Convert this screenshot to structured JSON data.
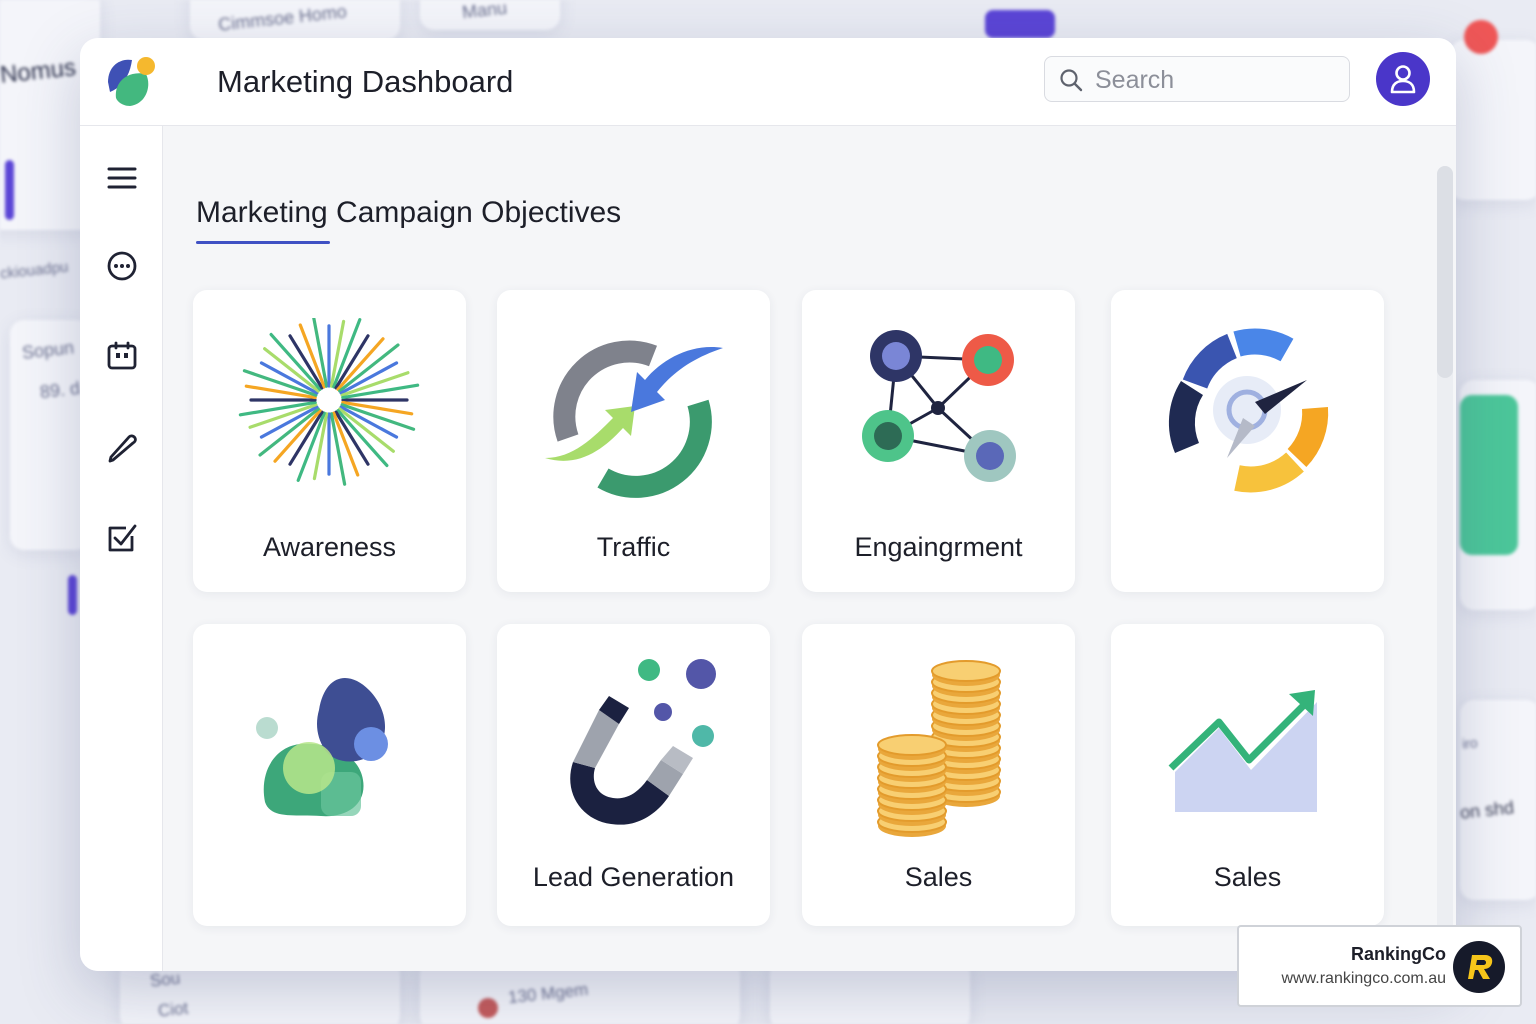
{
  "header": {
    "title": "Marketing Dashboard",
    "search_placeholder": "Search",
    "logo_icon": "leaf-logo-icon",
    "avatar_icon": "user-icon",
    "avatar_color": "#4a36c9"
  },
  "sidebar": {
    "items": [
      {
        "icon": "menu-icon"
      },
      {
        "icon": "chat-icon"
      },
      {
        "icon": "badge-icon"
      },
      {
        "icon": "pencil-icon"
      },
      {
        "icon": "checkbox-icon"
      }
    ]
  },
  "main": {
    "section_title": "Marketing Campaign Objectives",
    "accent_color": "#3f51c4",
    "cards": [
      {
        "label": "Awareness",
        "icon": "starburst-icon"
      },
      {
        "label": "Traffic",
        "icon": "circular-arrows-icon"
      },
      {
        "label": "Engaingrment",
        "icon": "network-icon"
      },
      {
        "label": "",
        "icon": "compass-gauge-icon"
      },
      {
        "label": "",
        "icon": "blob-shapes-icon"
      },
      {
        "label": "Lead Generation",
        "icon": "magnet-icon"
      },
      {
        "label": "Sales",
        "icon": "coins-icon"
      },
      {
        "label": "Sales",
        "icon": "growth-chart-icon"
      }
    ]
  },
  "badge": {
    "name": "RankingCo",
    "url": "www.rankingco.com.au",
    "logo_icon": "rankingco-logo-icon"
  },
  "background": {
    "texts": [
      "Nomus",
      "Cimmsoe Homo",
      "Manu",
      "Sopun",
      "89. d",
      "ckiouadpu",
      "130 Mgem",
      "Ciot",
      "Sou",
      "on shd",
      "iro"
    ]
  }
}
